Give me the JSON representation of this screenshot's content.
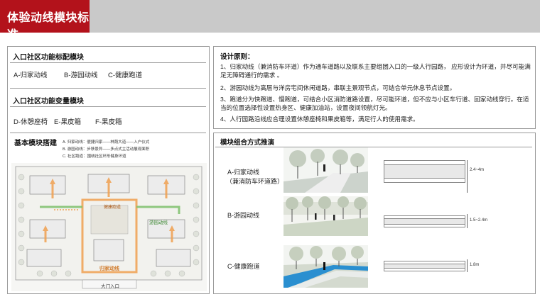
{
  "header": {
    "title": "体验动线模块标准"
  },
  "left": {
    "standard_title": "入口社区功能标配模块",
    "standard_items": [
      "A-归家动线",
      "B-游园动线",
      "C-健康跑道"
    ],
    "variable_title": "入口社区功能变量模块",
    "variable_items": [
      "D-休憩座椅",
      "E-果皮箱",
      "F-果皮箱"
    ],
    "basic_title": "基本模块搭建",
    "legend": [
      "A. 归家动线：便捷归家——林荫大道——入户仪式",
      "B. 游园动线：步移景异——多点式主活动展现面积",
      "C. 社区跑道：围绕社区环形健身环道"
    ],
    "plan_labels": {
      "c_label": "健康跑道",
      "b_label": "游园动线",
      "a_label": "归家动线",
      "gate": "大门入口"
    }
  },
  "right": {
    "principles_title": "设计原则：",
    "principles": [
      "1、归家动线（兼消防车环道）作为通车道路以及联系主要组团入口的一级人行园路， 应形设计为环道，并尽可能满足无障碍通行的需求 。",
      "2、游园动线为高层与洋房宅间休闲道路，串联主景观节点，可结合单元休息节点设置。",
      "3、跑道分为快跑道、慢跑道，可结合小区消防道路设置，尽可能环道，但不应与小区车行道、回家动线穿行。在适当的位置选择性设置热身区、健康加油站，设置夜间领航灯光。",
      "4、人行园路沿线应合理设置休憩座椅和果皮箱等，满足行人的使用需求。"
    ],
    "combo_title": "模块组合方式推演",
    "rows": [
      {
        "label_line1": "A-归家动线",
        "label_line2": "（兼消防车环道路）",
        "dim": "2.4~4m"
      },
      {
        "label_line1": "B-游园动线",
        "label_line2": "",
        "dim": "1.5~2.4m"
      },
      {
        "label_line1": "C-健康跑道",
        "label_line2": "",
        "dim": "1.8m"
      }
    ]
  },
  "colors": {
    "brand_red": "#b3121b",
    "header_gray": "#c9c9c9",
    "route_orange": "#f0a050",
    "route_green": "#7cc06a",
    "track_blue": "#2a8fd0"
  }
}
